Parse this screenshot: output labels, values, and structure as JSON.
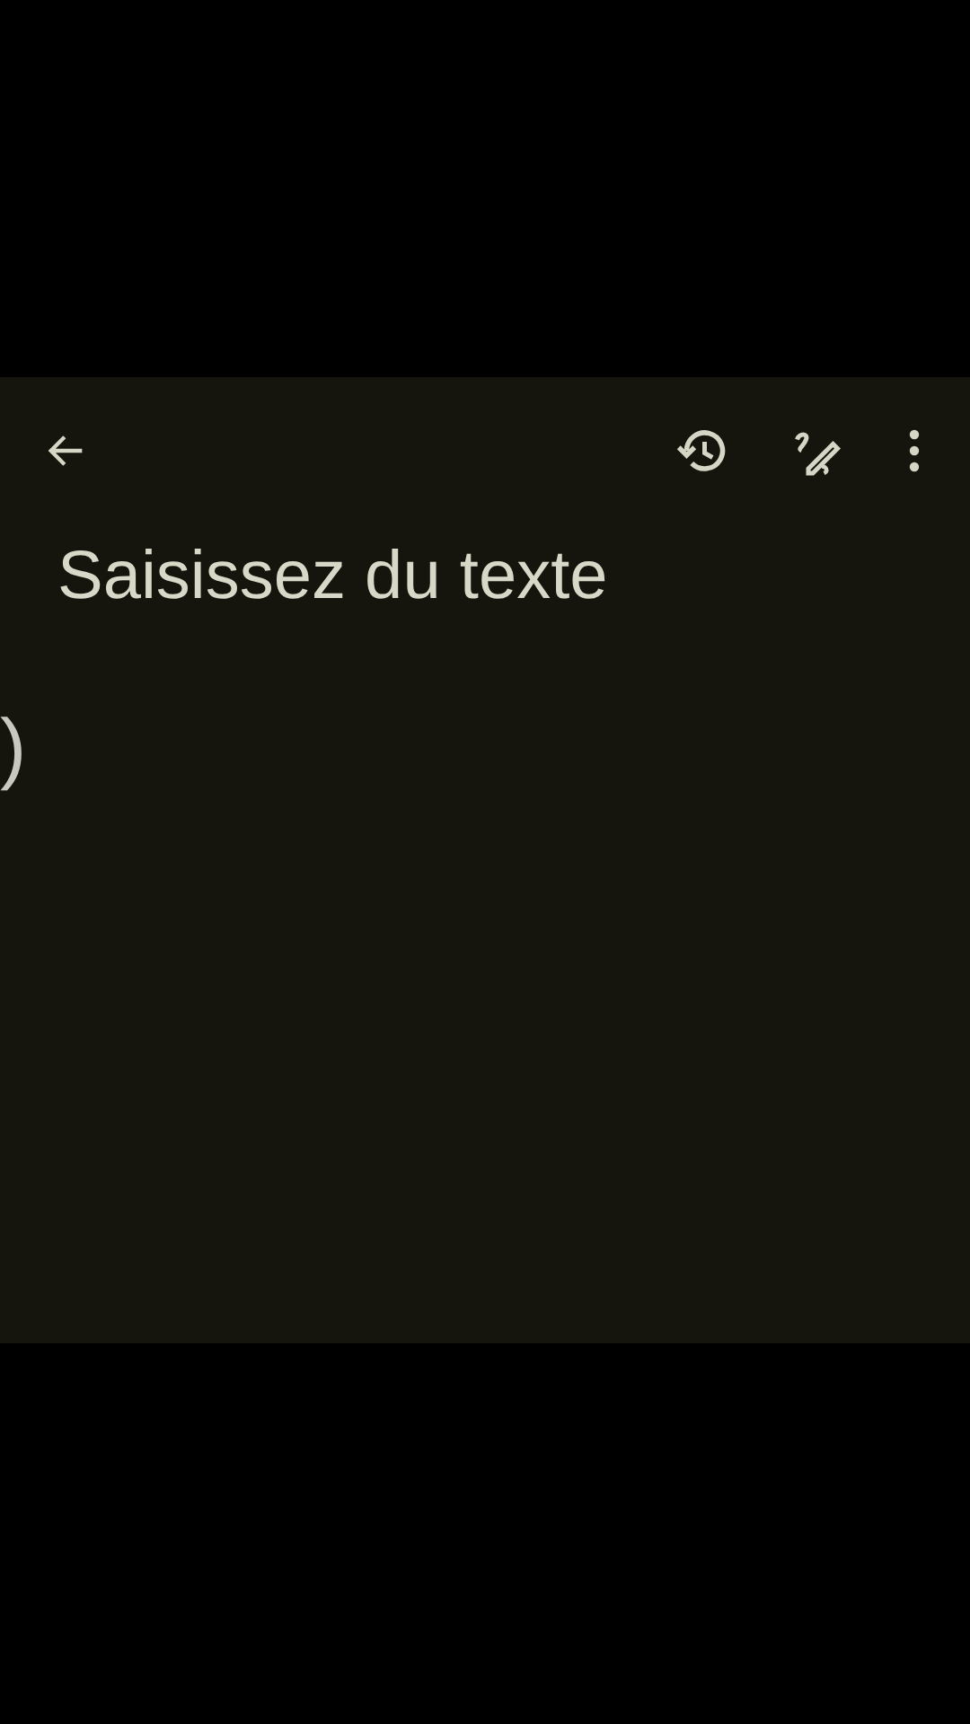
{
  "toolbar": {
    "actions": [
      {
        "kind": "history"
      },
      {
        "kind": "pen"
      },
      {
        "kind": "more"
      }
    ]
  },
  "note": {
    "placeholder": "Saisissez du texte",
    "edge_mark": ")"
  }
}
